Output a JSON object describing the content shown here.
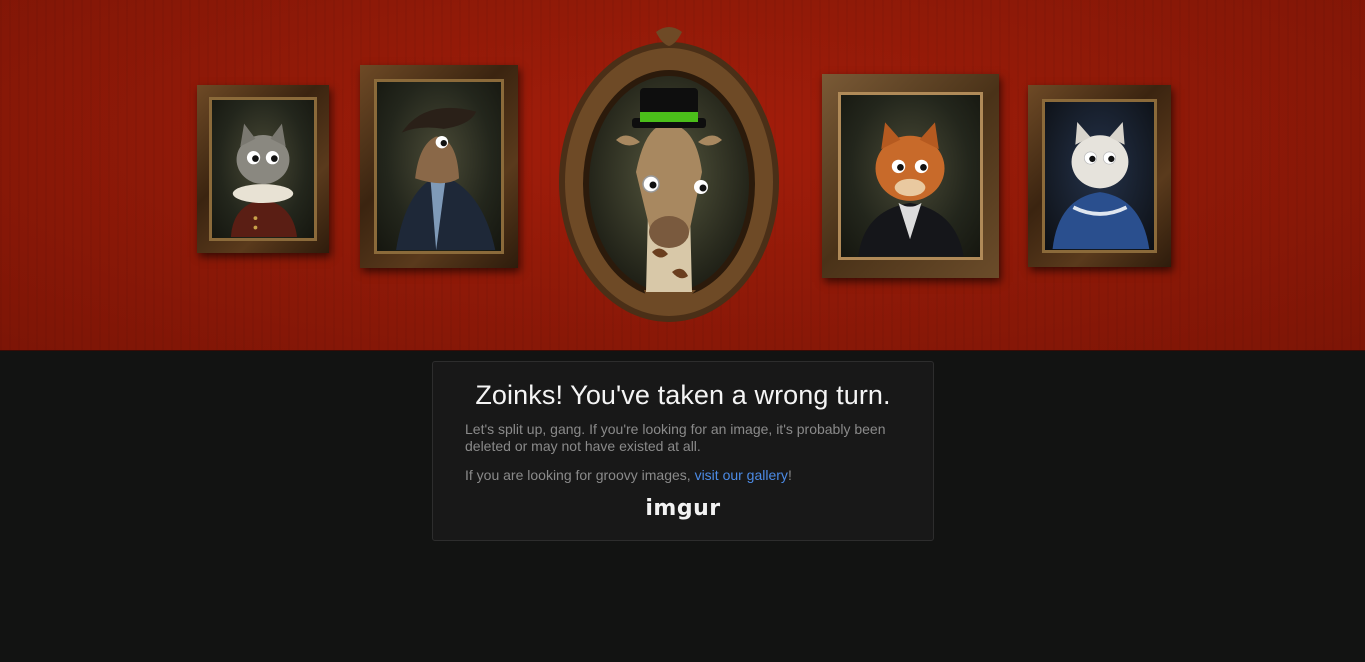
{
  "hero": {
    "frames": [
      {
        "subject": "grey-cat-ruff"
      },
      {
        "subject": "otter-admiral"
      },
      {
        "subject": "giraffe-top-hat"
      },
      {
        "subject": "orange-cat-cravat"
      },
      {
        "subject": "white-cat-blue-gown"
      }
    ]
  },
  "error": {
    "title": "Zoinks! You've taken a wrong turn.",
    "message": "Let's split up, gang. If you're looking for an image, it's probably been deleted or may not have existed at all.",
    "gallery_prefix": "If you are looking for groovy images, ",
    "gallery_link": "visit our gallery",
    "gallery_suffix": "!"
  },
  "brand": {
    "logo_text": "imgur",
    "link_color": "#4c8be6",
    "wall_color": "#921a08",
    "background_color": "#121312"
  }
}
